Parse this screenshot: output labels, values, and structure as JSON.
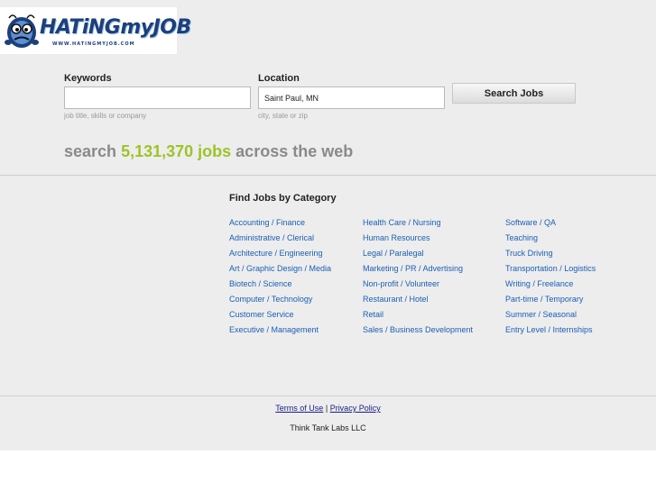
{
  "logo": {
    "text": "HATiNGmyJOB",
    "subtext": "WWW.HATINGMYJOB.COM"
  },
  "search": {
    "keywords_label": "Keywords",
    "keywords_value": "",
    "keywords_hint": "job title, skills or company",
    "location_label": "Location",
    "location_value": "Saint Paul, MN",
    "location_hint": "city, state or zip",
    "button_label": "Search Jobs"
  },
  "headline": {
    "prefix": "search",
    "count": "5,131,370 jobs",
    "suffix": "across the web"
  },
  "categories": {
    "title": "Find Jobs by Category",
    "col1": [
      "Accounting / Finance",
      "Administrative / Clerical",
      "Architecture / Engineering",
      "Art / Graphic Design / Media",
      "Biotech / Science",
      "Computer / Technology",
      "Customer Service",
      "Executive / Management"
    ],
    "col2": [
      "Health Care / Nursing",
      "Human Resources",
      "Legal / Paralegal",
      "Marketing / PR / Advertising",
      "Non-profit / Volunteer",
      "Restaurant / Hotel",
      "Retail",
      "Sales / Business Development"
    ],
    "col3": [
      "Software / QA",
      "Teaching",
      "Truck Driving",
      "Transportation / Logistics",
      "Writing / Freelance",
      "Part-time / Temporary",
      "Summer / Seasonal",
      "Entry Level / Internships"
    ]
  },
  "footer": {
    "terms": "Terms of Use",
    "separator": "|",
    "privacy": "Privacy Policy",
    "company": "Think Tank Labs LLC"
  },
  "colors": {
    "background": "#ededed",
    "link": "#1a5fb4",
    "count_accent": "#9cc427",
    "headline_gray": "#8a8a8a"
  }
}
